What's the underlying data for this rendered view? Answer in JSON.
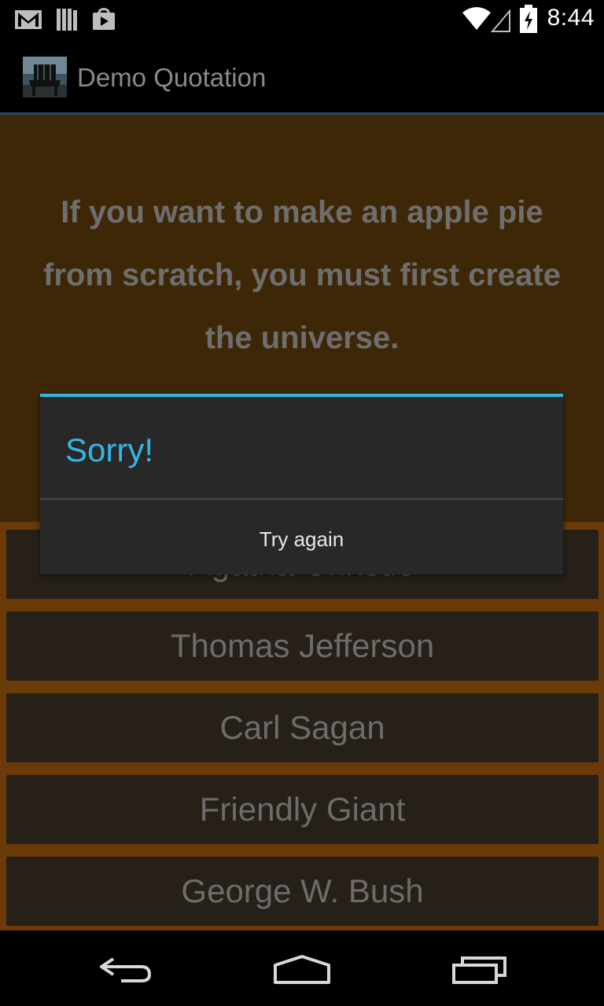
{
  "status_bar": {
    "time": "8:44",
    "icons": [
      "gmail-icon",
      "library-icon",
      "play-store-icon",
      "wifi-icon",
      "signal-icon",
      "battery-icon"
    ]
  },
  "action_bar": {
    "title": "Demo Quotation",
    "icon": "app-chair-icon"
  },
  "quote": {
    "text": "If you want to make an apple pie from scratch, you must first create the universe."
  },
  "answers": [
    "Agatha Christie",
    "Thomas Jefferson",
    "Carl Sagan",
    "Friendly Giant",
    "George W. Bush"
  ],
  "dialog": {
    "title": "Sorry!",
    "button_label": "Try again"
  },
  "nav_bar": {
    "buttons": [
      "back-icon",
      "home-icon",
      "recents-icon"
    ]
  },
  "colors": {
    "accent": "#33b5e5",
    "quote_bg": "#3e2707",
    "answers_bg": "#6a3a08",
    "answer_button": "#262019",
    "dialog_bg": "#282828"
  }
}
